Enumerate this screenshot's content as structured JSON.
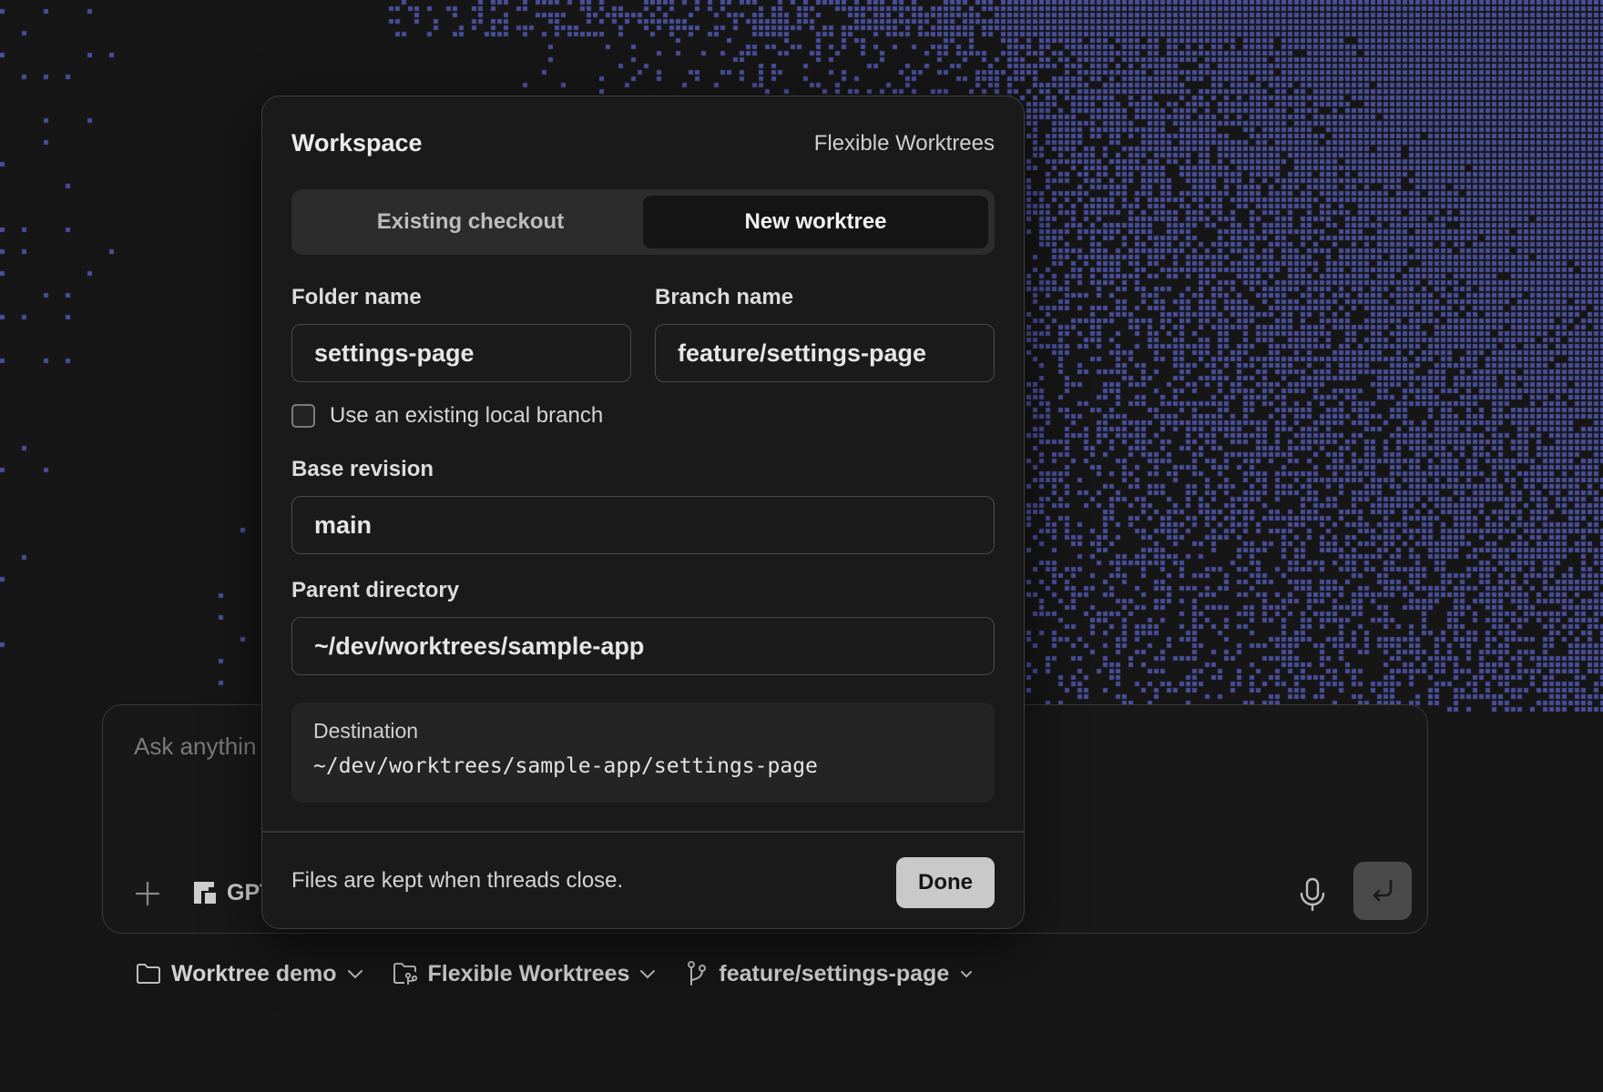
{
  "theme": {
    "background": "#161616",
    "accent_pattern": "#4a4f9a"
  },
  "composer": {
    "placeholder": "Ask anythin",
    "model_label": "GPT",
    "icons": {
      "add": "plus-icon",
      "model": "model-logo-icon",
      "voice": "microphone-icon",
      "send": "send-arrow-icon"
    }
  },
  "bottom_bar": {
    "project": {
      "label": "Worktree demo",
      "icon": "folder-icon"
    },
    "workspace": {
      "label": "Flexible Worktrees",
      "icon": "worktree-folder-icon"
    },
    "branch": {
      "label": "feature/settings-page",
      "icon": "git-branch-icon"
    }
  },
  "popover": {
    "title": "Workspace",
    "context": "Flexible Worktrees",
    "tabs": [
      {
        "label": "Existing checkout",
        "active": false
      },
      {
        "label": "New worktree",
        "active": true
      }
    ],
    "folder_name": {
      "label": "Folder name",
      "value": "settings-page"
    },
    "branch_name": {
      "label": "Branch name",
      "value": "feature/settings-page"
    },
    "use_existing_branch": {
      "label": "Use an existing local branch",
      "checked": false
    },
    "base_revision": {
      "label": "Base revision",
      "value": "main"
    },
    "parent_directory": {
      "label": "Parent directory",
      "value": "~/dev/worktrees/sample-app"
    },
    "destination": {
      "label": "Destination",
      "path": "~/dev/worktrees/sample-app/settings-page"
    },
    "footnote": "Files are kept when threads close.",
    "done_label": "Done"
  }
}
